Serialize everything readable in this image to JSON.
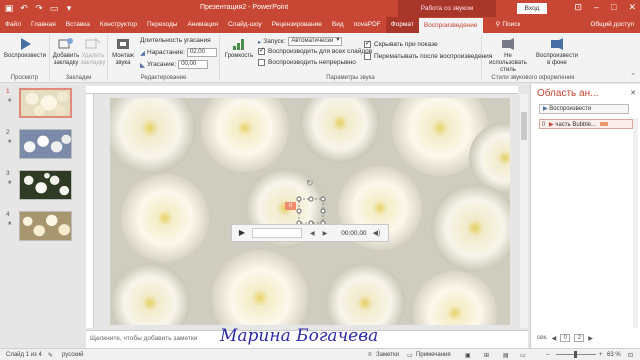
{
  "titlebar": {
    "title": "Презентация2 - PowerPoint",
    "context_group": "Работа со звуком",
    "signin": "Вход",
    "qat": [
      "save-icon",
      "undo-icon",
      "redo-icon",
      "present-icon",
      "customize-icon"
    ]
  },
  "tabs": {
    "items": [
      "Файл",
      "Главная",
      "Вставка",
      "Конструктор",
      "Переходы",
      "Анимация",
      "Слайд-шоу",
      "Рецензирование",
      "Вид",
      "novaPDF",
      "Формат",
      "Воспроизведение"
    ],
    "search": "Поиск",
    "share": "Общий доступ"
  },
  "ribbon": {
    "play": "Воспроизвести",
    "preview_group": "Просмотр",
    "add_bookmark": "Добавить закладку",
    "remove_bookmark": "Удалить закладку",
    "bookmarks_group": "Закладки",
    "trim": "Монтаж звука",
    "fade_label": "Длительность угасания",
    "fade_in_label": "Нарастание:",
    "fade_in_value": "02,00",
    "fade_out_label": "Угасание:",
    "fade_out_value": "00,00",
    "editing_group": "Редактирование",
    "volume": "Громкость",
    "start_label": "Запуск:",
    "start_value": "Автоматически",
    "play_across": "Воспроизводить для всех слайдов",
    "loop": "Воспроизводить непрерывно",
    "hide": "Скрывать при показе",
    "rewind": "Перематывать после воспроизведения",
    "options_group": "Параметры звука",
    "no_style": "Не использовать стиль",
    "bg_play": "Воспроизвести в фоне",
    "styles_group": "Стили звукового оформления"
  },
  "slides": [
    {
      "num": "1",
      "active": true
    },
    {
      "num": "2",
      "active": false
    },
    {
      "num": "3",
      "active": false
    },
    {
      "num": "4",
      "active": false
    }
  ],
  "player": {
    "time": "00:00,00"
  },
  "trigger_badge": "0",
  "notes": {
    "hint": "Щелкните, чтобы добавить заметки",
    "signature": "Марина Богачева"
  },
  "anipane": {
    "title": "Область ан...",
    "play_button": "Воспроизвести",
    "item_num": "0",
    "item_label": "часть Bubble...",
    "footer_label": "сек. ",
    "footer_a": "0",
    "footer_b": "2"
  },
  "status": {
    "slide": "Слайд 1 из 4",
    "lang": "русский",
    "notes": "Заметки",
    "comments": "Примечания",
    "zoom": "63 %"
  },
  "colors": {
    "accent": "#c74634",
    "signature": "#2e2aa8"
  }
}
